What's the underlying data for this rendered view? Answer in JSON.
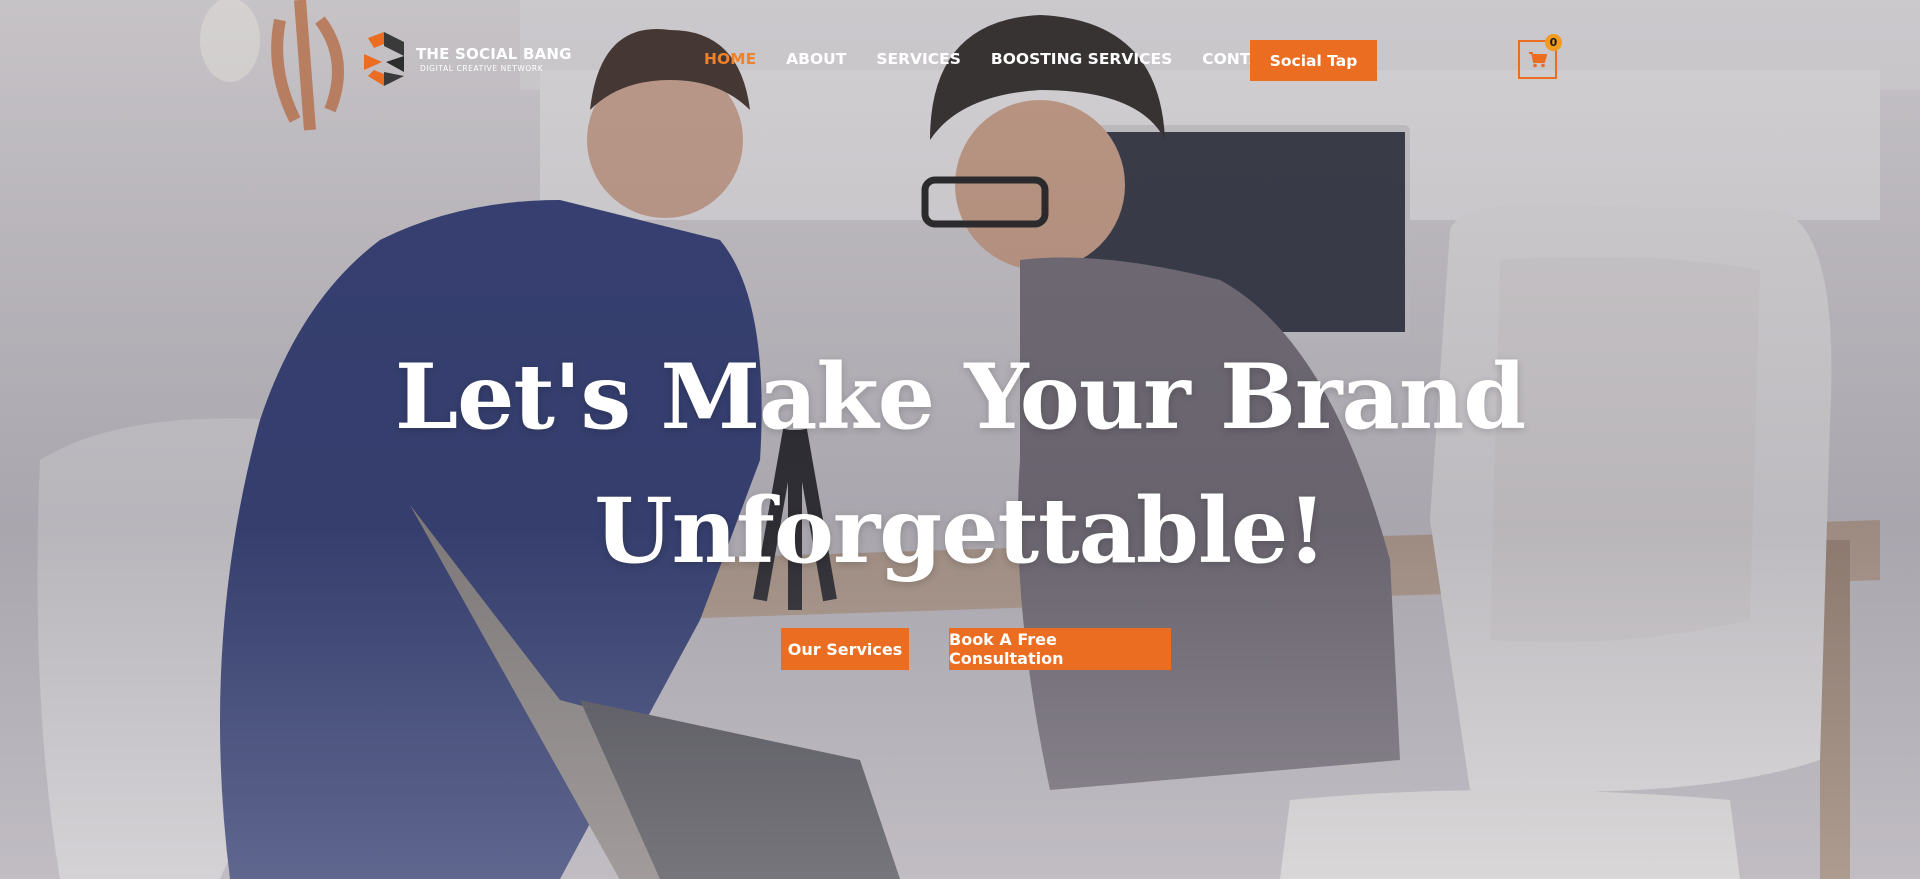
{
  "brand": {
    "name": "THE SOCIAL BANG",
    "tagline": "DIGITAL CREATIVE NETWORK",
    "accent": "#ea6d22",
    "logo_icon": "social-bang-logo"
  },
  "nav": {
    "items": [
      {
        "label": "HOME",
        "active": true
      },
      {
        "label": "ABOUT",
        "active": false
      },
      {
        "label": "SERVICES",
        "active": false
      },
      {
        "label": "BOOSTING SERVICES",
        "active": false
      },
      {
        "label": "CONTACT",
        "active": false
      }
    ],
    "cta_label": "Social Tap"
  },
  "cart": {
    "icon": "cart-icon",
    "count": "0"
  },
  "hero": {
    "headline_line1": "Let's Make Your Brand",
    "headline_line2": "Unforgettable!",
    "primary_cta": "Our Services",
    "secondary_cta": "Book A Free Consultation"
  }
}
